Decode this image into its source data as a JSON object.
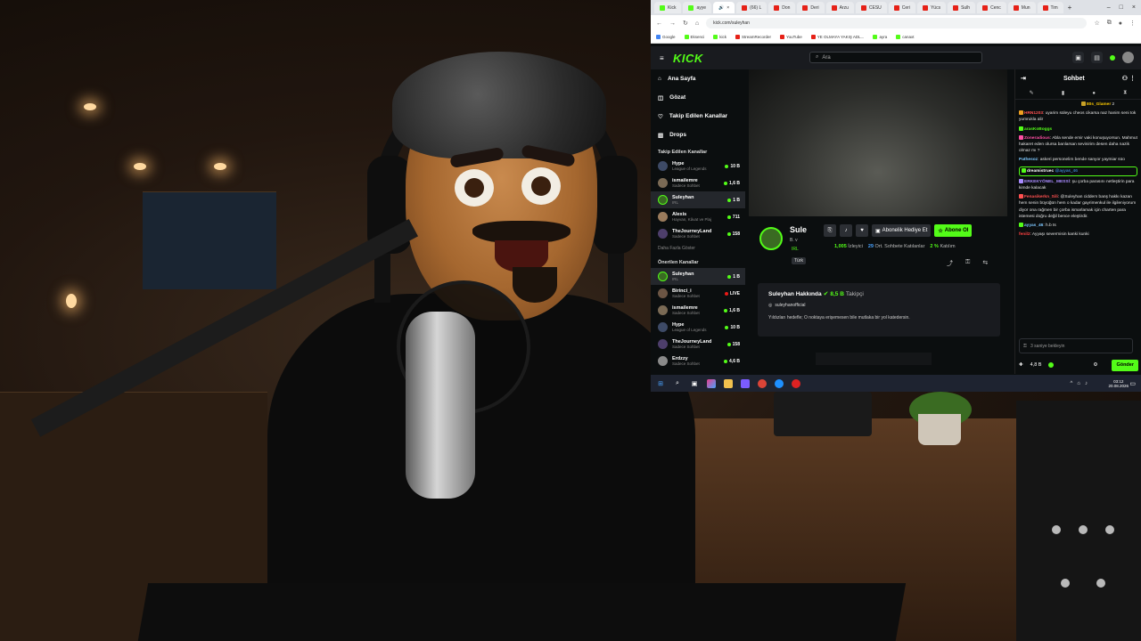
{
  "browser": {
    "tabs": [
      {
        "label": "Kick",
        "icon": "kick"
      },
      {
        "label": "ayye",
        "icon": "kick"
      },
      {
        "label": "",
        "icon": "speaker",
        "active": true
      },
      {
        "label": "(66) L",
        "icon": "youtube"
      },
      {
        "label": "Don",
        "icon": "youtube"
      },
      {
        "label": "Deri",
        "icon": "youtube"
      },
      {
        "label": "Arzu",
        "icon": "youtube"
      },
      {
        "label": "CESU",
        "icon": "youtube"
      },
      {
        "label": "Ceri",
        "icon": "youtube"
      },
      {
        "label": "Yücs",
        "icon": "youtube"
      },
      {
        "label": "Sulh",
        "icon": "youtube"
      },
      {
        "label": "Cenc",
        "icon": "youtube"
      },
      {
        "label": "Mun",
        "icon": "youtube"
      },
      {
        "label": "Tim",
        "icon": "youtube"
      }
    ],
    "url": "kick.com/suleyhan",
    "bookmarks": [
      "Google",
      "Eksenci",
      "kick",
      "StreamRecorder",
      "YouTube",
      "YE OLMAYA YAKIŞ ADL...",
      "ayra",
      "canaxt"
    ]
  },
  "kick": {
    "logo": "KICK",
    "search_placeholder": "Ara",
    "nav_main": [
      {
        "label": "Ana Sayfa",
        "icon": "home-icon"
      },
      {
        "label": "Gözat",
        "icon": "compass-icon"
      },
      {
        "label": "Takip Edilen Kanallar",
        "icon": "heart-icon"
      },
      {
        "label": "Drops",
        "icon": "drops-icon"
      }
    ],
    "followed_title": "Takip Edilen Kanallar",
    "followed": [
      {
        "name": "Hype",
        "category": "League of Legends",
        "viewers": "10 B",
        "live": "green"
      },
      {
        "name": "ismailemre",
        "category": "Sadece Sohbet",
        "viewers": "1,6 B",
        "live": "green"
      },
      {
        "name": "Suleyhan",
        "category": "IRL",
        "viewers": "1 B",
        "live": "green",
        "selected": true
      },
      {
        "name": "Alexis",
        "category": "Hayvan, Kâvat ve Plaj",
        "viewers": "711",
        "live": "green"
      },
      {
        "name": "TheJourneyLand",
        "category": "Sadece Sohbet",
        "viewers": "158",
        "live": "green"
      }
    ],
    "show_more": "Daha Fazla Göster",
    "recommended_title": "Önerilen Kanallar",
    "recommended": [
      {
        "name": "Suleyhan",
        "category": "IRL",
        "viewers": "1 B",
        "live": "green",
        "selected": true
      },
      {
        "name": "Birinci_i",
        "category": "Sadece Sohbet",
        "viewers": "LIVE",
        "live": "red"
      },
      {
        "name": "ismailemre",
        "category": "Sadece Sohbet",
        "viewers": "1,6 B",
        "live": "green"
      },
      {
        "name": "Hype",
        "category": "League of Legends",
        "viewers": "10 B",
        "live": "green"
      },
      {
        "name": "TheJourneyLand",
        "category": "Sadece Sohbet",
        "viewers": "158",
        "live": "green"
      },
      {
        "name": "Erdzzy",
        "category": "Sadece Sohbet",
        "viewers": "4,6 B",
        "live": "green"
      }
    ],
    "stream": {
      "streamer": "Sule",
      "title": "B. v",
      "category": "IRL",
      "tag": "Türk",
      "gift_label": "Abonelik Hediye Et",
      "subscribe_label": "Abone Ol",
      "viewers": "1,005",
      "viewers_label": "İzleyici",
      "chatters": "29",
      "chatters_label": "Ort. Sohbete Katılanlar",
      "participation": "2 %",
      "participation_label": "Katılım"
    },
    "about": {
      "title": "Suleyhan Hakkında",
      "followers": "8,5 B",
      "followers_label": "Takipçi",
      "social": "suleyhanofficial",
      "description": "Yıldızları hedefle; O noktaya erişemesen bile mutlaka bir yol katedersin."
    },
    "chat": {
      "title": "Sohbet",
      "messages": [
        {
          "user": "80s_Glamer",
          "color": "#f5c400",
          "text": "2",
          "badge": true
        },
        {
          "user": "HRN1203",
          "color": "#ff5050",
          "text": ": uyarim süleyu cheos cikarsa naz hanim seni tok yumrukla alir"
        },
        {
          "user": "arasKoBoggs",
          "color": "#53fc18",
          "text": ""
        },
        {
          "user": "Zoneradious",
          "color": "#ff4fa3",
          "text": ": Abla sende emir vaki konuşuyorsun. Mahmut hakaret eden olursa banlarsan sevinirim desen daha nazik olmaz mı ?"
        },
        {
          "user": "Pathesoz",
          "color": "#7ec8ff",
          "text": ": askeri personelim bende sanyor yaymiar süo"
        },
        {
          "user": "dreamistruec",
          "color": "#ffffff",
          "text": "@ayyas_46",
          "highlight": true
        },
        {
          "user": "ERKEKYÖNEL_MESSİ",
          "color": "#a98bff",
          "text": ": şu çorba parasını netleştirin para kimde kalacak"
        },
        {
          "user": "Fenasikerkn_Sili",
          "color": "#ff5050",
          "text": ": @Suleyhan ciddem banş hakkı kazan hem senin büyüğün hem o kadar gayrimenkul ile ilgileniyorum diyor ona rağmen bir çorba ismarlamak için charten para istemesi doğru değil bence eleştirdir."
        },
        {
          "user": "ayyas_46",
          "color": "#7ec8ff",
          "text": ": h.b ts"
        },
        {
          "user": "fenil2",
          "color": "#ff4040",
          "text": ": Ayyaşı severmisin kanki kunki"
        }
      ],
      "wait_placeholder": "3 saniye bekleyin",
      "points": "4,8 B",
      "send_label": "Gönder"
    }
  },
  "taskbar": {
    "time": "03:12",
    "date": "20.08.2026"
  },
  "colors": {
    "kick_green": "#53fc18",
    "kick_bg": "#0b0e0f"
  }
}
